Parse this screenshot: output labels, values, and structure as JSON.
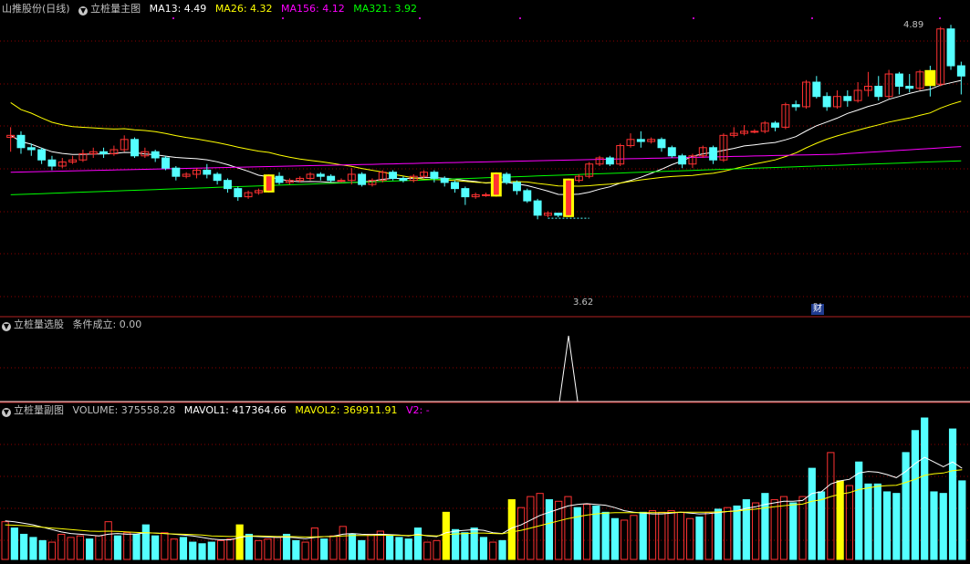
{
  "main": {
    "stock_title": "山推股份(日线)",
    "indicator_name": "立桩量主图",
    "ma13": "MA13: 4.49",
    "ma26": "MA26: 4.32",
    "ma156": "MA156: 4.12",
    "ma321": "MA321: 3.92",
    "high_label": "4.89",
    "low_label": "3.62",
    "event_badge": "财"
  },
  "select_panel": {
    "name": "立桩量选股",
    "condition": "条件成立: 0.00"
  },
  "volume_panel": {
    "name": "立桩量副图",
    "volume": "VOLUME: 375558.28",
    "mavol1": "MAVOL1: 417364.66",
    "mavol2": "MAVOL2: 369911.91",
    "v2": "V2: -"
  },
  "colors": {
    "up": "#ff3232",
    "down": "#54ffff",
    "pile": "#ffff00",
    "ma13": "#ffffff",
    "ma26": "#ffff00",
    "ma156": "#ff00ff",
    "ma321": "#00ff00",
    "grid": "#8b0000"
  },
  "chart_data": {
    "type": "candlestick",
    "ylim": [
      3.55,
      4.95
    ],
    "candles": [
      [
        4.35,
        4.36,
        4.28,
        4.4
      ],
      [
        4.36,
        4.3,
        4.27,
        4.38
      ],
      [
        4.3,
        4.29,
        4.26,
        4.32
      ],
      [
        4.29,
        4.24,
        4.22,
        4.3
      ],
      [
        4.24,
        4.21,
        4.19,
        4.26
      ],
      [
        4.21,
        4.23,
        4.2,
        4.25
      ],
      [
        4.23,
        4.24,
        4.22,
        4.26
      ],
      [
        4.24,
        4.27,
        4.23,
        4.29
      ],
      [
        4.27,
        4.28,
        4.25,
        4.3
      ],
      [
        4.28,
        4.27,
        4.25,
        4.3
      ],
      [
        4.27,
        4.29,
        4.26,
        4.31
      ],
      [
        4.29,
        4.34,
        4.28,
        4.36
      ],
      [
        4.34,
        4.26,
        4.25,
        4.35
      ],
      [
        4.26,
        4.28,
        4.25,
        4.3
      ],
      [
        4.28,
        4.25,
        4.23,
        4.29
      ],
      [
        4.25,
        4.2,
        4.19,
        4.26
      ],
      [
        4.2,
        4.16,
        4.14,
        4.21
      ],
      [
        4.16,
        4.17,
        4.15,
        4.18
      ],
      [
        4.17,
        4.19,
        4.15,
        4.2
      ],
      [
        4.19,
        4.17,
        4.15,
        4.22
      ],
      [
        4.17,
        4.14,
        4.12,
        4.18
      ],
      [
        4.14,
        4.1,
        4.08,
        4.15
      ],
      [
        4.1,
        4.06,
        4.04,
        4.11
      ],
      [
        4.06,
        4.08,
        4.05,
        4.09
      ],
      [
        4.08,
        4.09,
        4.07,
        4.1
      ],
      [
        4.09,
        4.16,
        4.08,
        4.17
      ],
      [
        4.16,
        4.13,
        4.12,
        4.18
      ],
      [
        4.13,
        4.14,
        4.12,
        4.15
      ],
      [
        4.14,
        4.15,
        4.13,
        4.16
      ],
      [
        4.15,
        4.17,
        4.14,
        4.18
      ],
      [
        4.17,
        4.16,
        4.14,
        4.18
      ],
      [
        4.16,
        4.14,
        4.13,
        4.17
      ],
      [
        4.14,
        4.14,
        4.13,
        4.15
      ],
      [
        4.14,
        4.17,
        4.12,
        4.2
      ],
      [
        4.17,
        4.12,
        4.11,
        4.18
      ],
      [
        4.12,
        4.14,
        4.11,
        4.15
      ],
      [
        4.14,
        4.18,
        4.13,
        4.19
      ],
      [
        4.18,
        4.15,
        4.14,
        4.19
      ],
      [
        4.15,
        4.14,
        4.13,
        4.16
      ],
      [
        4.14,
        4.16,
        4.13,
        4.17
      ],
      [
        4.16,
        4.18,
        4.15,
        4.19
      ],
      [
        4.18,
        4.15,
        4.13,
        4.19
      ],
      [
        4.15,
        4.13,
        4.11,
        4.16
      ],
      [
        4.13,
        4.1,
        4.08,
        4.14
      ],
      [
        4.1,
        4.06,
        4.02,
        4.11
      ],
      [
        4.06,
        4.07,
        4.05,
        4.08
      ],
      [
        4.07,
        4.07,
        4.06,
        4.08
      ],
      [
        4.07,
        4.17,
        4.06,
        4.18
      ],
      [
        4.17,
        4.13,
        4.12,
        4.18
      ],
      [
        4.13,
        4.09,
        4.07,
        4.14
      ],
      [
        4.09,
        4.04,
        4.03,
        4.1
      ],
      [
        4.04,
        3.97,
        3.95,
        4.05
      ],
      [
        3.97,
        3.98,
        3.96,
        3.99
      ],
      [
        3.98,
        3.97,
        3.96,
        3.98
      ],
      [
        3.97,
        4.14,
        3.96,
        4.15
      ],
      [
        4.14,
        4.16,
        4.13,
        4.17
      ],
      [
        4.16,
        4.22,
        4.15,
        4.23
      ],
      [
        4.22,
        4.25,
        4.21,
        4.26
      ],
      [
        4.25,
        4.22,
        4.21,
        4.26
      ],
      [
        4.22,
        4.31,
        4.21,
        4.32
      ],
      [
        4.31,
        4.34,
        4.3,
        4.37
      ],
      [
        4.34,
        4.33,
        4.3,
        4.38
      ],
      [
        4.33,
        4.34,
        4.32,
        4.35
      ],
      [
        4.34,
        4.3,
        4.28,
        4.35
      ],
      [
        4.3,
        4.26,
        4.25,
        4.31
      ],
      [
        4.26,
        4.22,
        4.2,
        4.27
      ],
      [
        4.22,
        4.26,
        4.2,
        4.27
      ],
      [
        4.26,
        4.3,
        4.25,
        4.31
      ],
      [
        4.3,
        4.24,
        4.22,
        4.31
      ],
      [
        4.24,
        4.36,
        4.23,
        4.37
      ],
      [
        4.36,
        4.37,
        4.35,
        4.4
      ],
      [
        4.37,
        4.38,
        4.36,
        4.41
      ],
      [
        4.38,
        4.38,
        4.37,
        4.39
      ],
      [
        4.38,
        4.42,
        4.37,
        4.43
      ],
      [
        4.42,
        4.4,
        4.38,
        4.43
      ],
      [
        4.4,
        4.51,
        4.39,
        4.52
      ],
      [
        4.51,
        4.5,
        4.48,
        4.53
      ],
      [
        4.5,
        4.62,
        4.49,
        4.63
      ],
      [
        4.62,
        4.55,
        4.54,
        4.65
      ],
      [
        4.55,
        4.5,
        4.48,
        4.57
      ],
      [
        4.5,
        4.55,
        4.49,
        4.58
      ],
      [
        4.55,
        4.53,
        4.5,
        4.58
      ],
      [
        4.53,
        4.58,
        4.52,
        4.62
      ],
      [
        4.58,
        4.6,
        4.55,
        4.67
      ],
      [
        4.6,
        4.55,
        4.53,
        4.65
      ],
      [
        4.55,
        4.66,
        4.54,
        4.68
      ],
      [
        4.66,
        4.6,
        4.56,
        4.67
      ],
      [
        4.6,
        4.59,
        4.57,
        4.66
      ],
      [
        4.59,
        4.67,
        4.58,
        4.68
      ],
      [
        4.67,
        4.61,
        4.55,
        4.7
      ],
      [
        4.61,
        4.88,
        4.6,
        4.89
      ],
      [
        4.88,
        4.7,
        4.68,
        4.9
      ],
      [
        4.7,
        4.65,
        4.56,
        4.72
      ]
    ],
    "volume_ylim": [
      0,
      900000
    ],
    "volume": [
      240000,
      200000,
      160000,
      140000,
      120000,
      110000,
      160000,
      140000,
      150000,
      130000,
      150000,
      240000,
      150000,
      170000,
      160000,
      220000,
      150000,
      170000,
      130000,
      140000,
      110000,
      100000,
      110000,
      120000,
      130000,
      220000,
      160000,
      120000,
      130000,
      140000,
      160000,
      120000,
      110000,
      200000,
      130000,
      150000,
      210000,
      160000,
      120000,
      160000,
      180000,
      150000,
      140000,
      130000,
      200000,
      110000,
      120000,
      300000,
      190000,
      170000,
      200000,
      140000,
      110000,
      120000,
      380000,
      330000,
      400000,
      420000,
      380000,
      370000,
      400000,
      330000,
      350000,
      340000,
      300000,
      260000,
      250000,
      280000,
      300000,
      310000,
      300000,
      310000,
      300000,
      260000,
      270000,
      300000,
      320000,
      330000,
      340000,
      380000,
      360000,
      420000,
      380000,
      400000,
      360000,
      400000,
      580000,
      430000,
      680000,
      500000,
      470000,
      620000,
      480000,
      480000,
      430000,
      420000,
      680000,
      820000,
      900000,
      430000,
      420000,
      830000,
      500000
    ],
    "mavol1": [
      245000,
      240000,
      230000,
      220000,
      205000,
      190000,
      175000,
      165000,
      160000,
      155000,
      150000,
      160000,
      165000,
      160000,
      162000,
      170000,
      168000,
      165000,
      160000,
      155000,
      150000,
      140000,
      130000,
      125000,
      125000,
      140000,
      148000,
      145000,
      142000,
      140000,
      142000,
      138000,
      132000,
      140000,
      145000,
      148000,
      160000,
      165000,
      160000,
      158000,
      160000,
      158000,
      155000,
      150000,
      160000,
      150000,
      145000,
      170000,
      180000,
      185000,
      190000,
      185000,
      170000,
      165000,
      200000,
      220000,
      250000,
      280000,
      300000,
      320000,
      340000,
      350000,
      355000,
      350000,
      345000,
      330000,
      310000,
      300000,
      295000,
      290000,
      290000,
      295000,
      300000,
      295000,
      290000,
      292000,
      298000,
      305000,
      310000,
      325000,
      335000,
      350000,
      360000,
      370000,
      370000,
      375000,
      420000,
      430000,
      480000,
      500000,
      510000,
      550000,
      560000,
      555000,
      540000,
      520000,
      560000,
      610000,
      650000,
      620000,
      590000,
      620000,
      580000
    ],
    "mavol2": [
      220000,
      218000,
      215000,
      210000,
      205000,
      200000,
      195000,
      190000,
      185000,
      180000,
      178000,
      180000,
      178000,
      175000,
      172000,
      170000,
      168000,
      165000,
      162000,
      160000,
      158000,
      155000,
      150000,
      148000,
      146000,
      148000,
      150000,
      150000,
      148000,
      146000,
      146000,
      145000,
      143000,
      144000,
      145000,
      146000,
      150000,
      152000,
      152000,
      152000,
      154000,
      154000,
      153000,
      152000,
      155000,
      152000,
      150000,
      158000,
      162000,
      165000,
      168000,
      168000,
      165000,
      163000,
      175000,
      185000,
      200000,
      215000,
      230000,
      245000,
      260000,
      272000,
      282000,
      290000,
      295000,
      298000,
      298000,
      298000,
      298000,
      298000,
      298000,
      299000,
      300000,
      300000,
      300000,
      300000,
      302000,
      305000,
      308000,
      315000,
      320000,
      328000,
      335000,
      342000,
      348000,
      352000,
      370000,
      380000,
      400000,
      415000,
      425000,
      445000,
      455000,
      465000,
      470000,
      472000,
      490000,
      510000,
      535000,
      545000,
      550000,
      565000,
      570000
    ],
    "select_signal": {
      "index": 54,
      "value": 1
    }
  }
}
